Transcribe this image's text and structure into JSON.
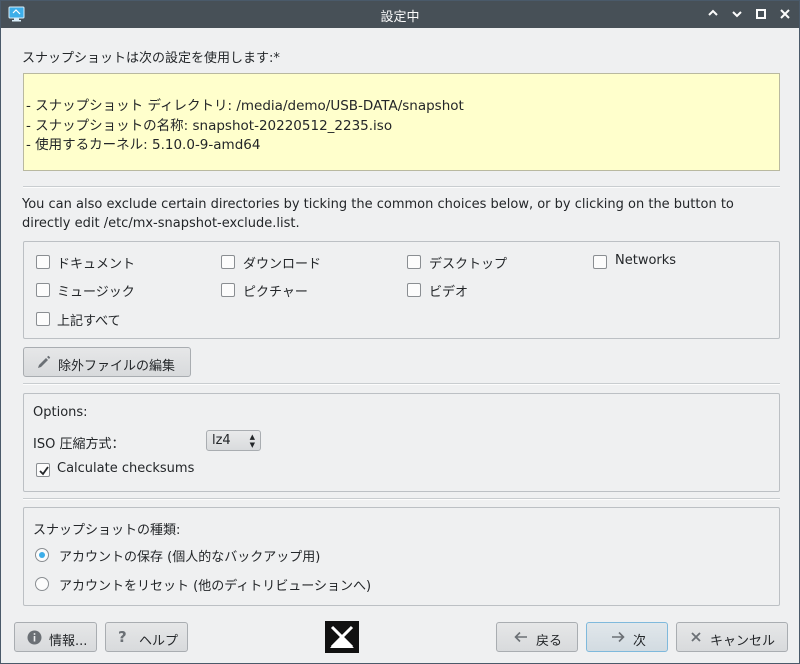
{
  "window": {
    "title": "設定中"
  },
  "info": {
    "heading": "スナップショットは次の設定を使用します:*",
    "lines": [
      "- スナップショット ディレクトリ:  /media/demo/USB-DATA/snapshot",
      "- スナップショットの名称: snapshot-20220512_2235.iso",
      "- 使用するカーネル:  5.10.0-9-amd64"
    ]
  },
  "exclude": {
    "description_line1": "You can also exclude certain directories by ticking the common choices below, or by clicking on the button to",
    "description_line2": "directly edit /etc/mx-snapshot-exclude.list.",
    "options": [
      {
        "label": "ドキュメント",
        "checked": false
      },
      {
        "label": "ダウンロード",
        "checked": false
      },
      {
        "label": "デスクトップ",
        "checked": false
      },
      {
        "label": "Networks",
        "checked": false
      },
      {
        "label": "ミュージック",
        "checked": false
      },
      {
        "label": "ピクチャー",
        "checked": false
      },
      {
        "label": "ビデオ",
        "checked": false
      },
      {
        "label": "上記すべて",
        "checked": false
      }
    ],
    "edit_button": "除外ファイルの編集"
  },
  "options": {
    "heading": "Options:",
    "compression_label": "ISO 圧縮方式：",
    "compression_value": "lz4",
    "checksums_label": "Calculate checksums",
    "checksums_checked": true
  },
  "snapshot_type": {
    "heading": "スナップショットの種類:",
    "choices": [
      {
        "label": "アカウントの保存 (個人的なバックアップ用)",
        "selected": true
      },
      {
        "label": "アカウントをリセット (他のディトリビューションへ)",
        "selected": false
      }
    ]
  },
  "footer": {
    "about": "情報...",
    "help": "ヘルプ",
    "back": "戻る",
    "next": "次",
    "cancel": "キャンセル"
  },
  "colors": {
    "accent": "#3daee9",
    "titlebar": "#475057",
    "info_bg": "#ffffcc"
  }
}
